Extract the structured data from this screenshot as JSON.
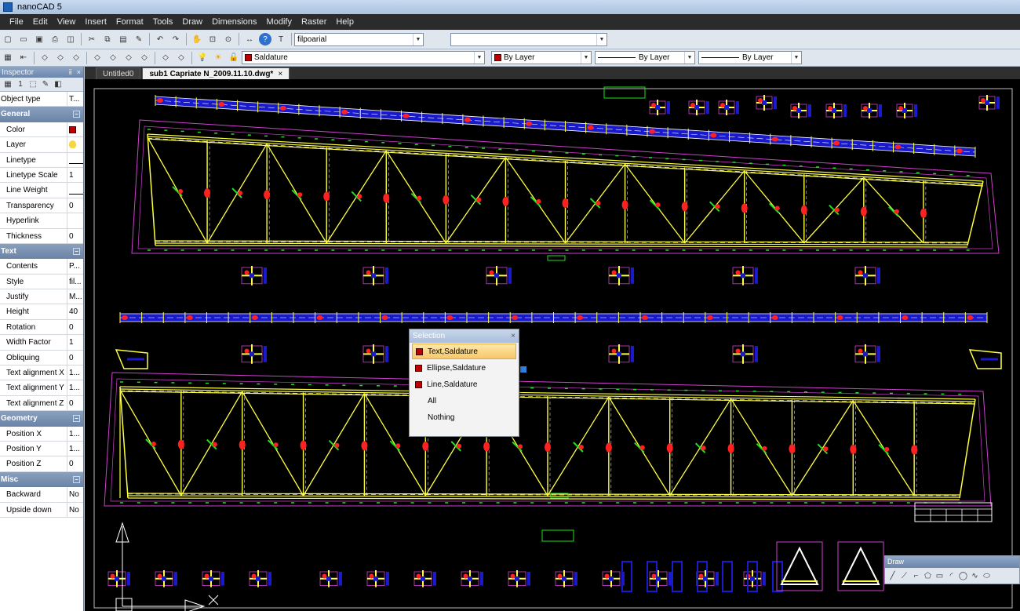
{
  "window": {
    "title": "nanoCAD 5"
  },
  "menu": [
    "File",
    "Edit",
    "View",
    "Insert",
    "Format",
    "Tools",
    "Draw",
    "Dimensions",
    "Modify",
    "Raster",
    "Help"
  ],
  "toolbar": {
    "font_combo": "filpoarial",
    "layer_combo": "Saldature",
    "color_combo": "By Layer",
    "linetype_combo": "By Layer",
    "lineweight_combo": "By Layer"
  },
  "inspector": {
    "title": "Inspector",
    "pin": "ⅱ",
    "close": "×",
    "rows": [
      {
        "type": "row",
        "key": "Object type",
        "value": "T..."
      },
      {
        "type": "cat",
        "key": "General"
      },
      {
        "type": "row",
        "key": "Color",
        "value": "",
        "icon": "color"
      },
      {
        "type": "row",
        "key": "Layer",
        "value": "",
        "icon": "bulb"
      },
      {
        "type": "row",
        "key": "Linetype",
        "value": "",
        "icon": "dash"
      },
      {
        "type": "row",
        "key": "Linetype Scale",
        "value": "1"
      },
      {
        "type": "row",
        "key": "Line Weight",
        "value": "",
        "icon": "dash"
      },
      {
        "type": "row",
        "key": "Transparency",
        "value": "0"
      },
      {
        "type": "row",
        "key": "Hyperlink",
        "value": ""
      },
      {
        "type": "row",
        "key": "Thickness",
        "value": "0"
      },
      {
        "type": "cat",
        "key": "Text"
      },
      {
        "type": "row",
        "key": "Contents",
        "value": "P..."
      },
      {
        "type": "row",
        "key": "Style",
        "value": "fil..."
      },
      {
        "type": "row",
        "key": "Justify",
        "value": "M..."
      },
      {
        "type": "row",
        "key": "Height",
        "value": "40"
      },
      {
        "type": "row",
        "key": "Rotation",
        "value": "0"
      },
      {
        "type": "row",
        "key": "Width Factor",
        "value": "1"
      },
      {
        "type": "row",
        "key": "Obliquing",
        "value": "0"
      },
      {
        "type": "row",
        "key": "Text alignment X",
        "value": "1..."
      },
      {
        "type": "row",
        "key": "Text alignment Y",
        "value": "1..."
      },
      {
        "type": "row",
        "key": "Text alignment Z",
        "value": "0"
      },
      {
        "type": "cat",
        "key": "Geometry"
      },
      {
        "type": "row",
        "key": "Position X",
        "value": "1..."
      },
      {
        "type": "row",
        "key": "Position Y",
        "value": "1..."
      },
      {
        "type": "row",
        "key": "Position Z",
        "value": "0"
      },
      {
        "type": "cat",
        "key": "Misc"
      },
      {
        "type": "row",
        "key": "Backward",
        "value": "No"
      },
      {
        "type": "row",
        "key": "Upside down",
        "value": "No"
      }
    ]
  },
  "tabs": [
    {
      "label": "Untitled0",
      "active": false
    },
    {
      "label": "sub1 Capriate N_2009.11.10.dwg*",
      "active": true,
      "close": "×"
    }
  ],
  "selection_popup": {
    "title": "Selection",
    "close": "×",
    "items": [
      {
        "label": "Text,Saldature",
        "swatch": true,
        "highlighted": true
      },
      {
        "label": "Ellipse,Saldature",
        "swatch": true,
        "highlighted": false
      },
      {
        "label": "Line,Saldature",
        "swatch": true,
        "highlighted": false
      },
      {
        "label": "All",
        "swatch": false,
        "highlighted": false
      },
      {
        "label": "Nothing",
        "swatch": false,
        "highlighted": false
      }
    ]
  },
  "draw_toolbar": {
    "title": "Draw"
  },
  "colors": {
    "canvas_bg": "#000000",
    "chord_yellow": "#ffff40",
    "frame_magenta": "#d040d0",
    "weld_red": "#ff2020",
    "dim_green": "#20e020",
    "bar_blue": "#1a1acd",
    "layer_red": "#c00000"
  },
  "icons": {
    "toolbar1": [
      "new-icon",
      "open-icon",
      "save-icon",
      "print-icon",
      "preview-icon",
      "cut-icon",
      "copy-icon",
      "paste-icon",
      "match-icon",
      "undo-icon",
      "redo-icon",
      "pan-icon",
      "zoom-window-icon",
      "zoom-prev-icon",
      "measure-icon",
      "help-icon",
      "text-style-icon"
    ],
    "toolbar2": [
      "layer-manager-icon",
      "layer-prev-icon",
      "bulb-icon",
      "sun-icon",
      "lock-icon"
    ]
  }
}
